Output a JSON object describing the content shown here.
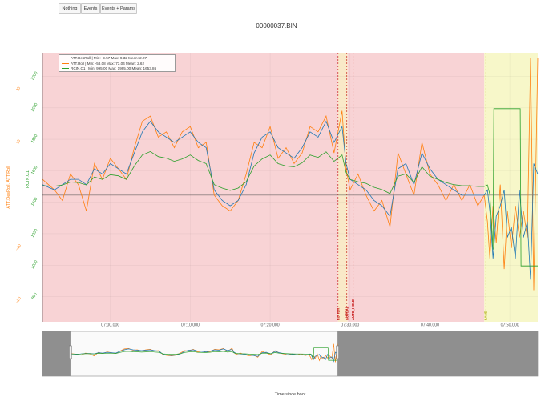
{
  "toolbar": {
    "buttons": [
      "Nothing",
      "Events",
      "Events + Params"
    ]
  },
  "colors": {
    "des_roll": "#1f77b4",
    "roll": "#ff7f0e",
    "rcin": "#2ca02c",
    "mode_red": "#f8d3d5",
    "mode_beige": "#f9e9c8",
    "mode_yellow": "#f7f7c9",
    "event_red": "#c00000",
    "event_yellow": "#a8a800"
  },
  "chart_data": {
    "type": "line",
    "title": "00000037.BIN",
    "xlabel": "Time since boot",
    "y_left_label": "ATT.DesRoll, ATT.Roll",
    "y_right_label": "RCIN.C1",
    "x_ticks": [
      "07:00.000",
      "07:10.000",
      "07:20.000",
      "07:30.000",
      "07:40.000",
      "07:50.000"
    ],
    "x_tick_seconds": [
      420,
      430,
      440,
      450,
      460,
      470
    ],
    "xlim_seconds": [
      411.5,
      473.5
    ],
    "yaxis_roll": {
      "range": [
        -24,
        27
      ],
      "ticks": [
        -20,
        -10,
        10,
        20
      ],
      "tick_labels": [
        "−20",
        "−10",
        "10",
        "20"
      ]
    },
    "yaxis_rcin": {
      "range": [
        640,
        2350
      ],
      "ticks": [
        800,
        1000,
        1200,
        1400,
        1600,
        1800,
        2000,
        2200
      ],
      "tick_labels": [
        "800",
        "1000",
        "1200",
        "1400",
        "1600",
        "1800",
        "2000",
        "2200"
      ]
    },
    "legend": [
      "ATT.DesRoll | Min: -9.57    Max: 9.32    Mean: 2.27",
      "ATT.Roll | Min: -58.08    Max: 73.04    Mean: 2.62",
      "RCIN.C1 | Min: 995.00    Max: 1995.00    Mean: 1653.86"
    ],
    "mode_bands": [
      {
        "from": 411.5,
        "to": 448.5,
        "color": "mode_red"
      },
      {
        "from": 448.5,
        "to": 449.7,
        "color": "mode_beige"
      },
      {
        "from": 449.7,
        "to": 466.8,
        "color": "mode_red"
      },
      {
        "from": 466.8,
        "to": 473.5,
        "color": "mode_yellow"
      }
    ],
    "events": [
      {
        "t": 448.5,
        "label": "LOITER",
        "color": "event_red"
      },
      {
        "t": 449.6,
        "label": "AUTOAL",
        "color": "event_red"
      },
      {
        "t": 450.4,
        "label": "AUTO_HOLD",
        "color": "event_red"
      },
      {
        "t": 467.0,
        "label": "LAND",
        "color": "event_yellow"
      }
    ],
    "series": [
      {
        "name": "ATT.DesRoll",
        "color": "des_roll",
        "x": [
          411.5,
          413,
          414,
          415,
          416,
          417,
          418,
          419,
          420,
          421,
          422,
          423,
          424,
          425,
          426,
          427,
          428,
          429,
          430,
          431,
          432,
          433,
          434,
          435,
          436,
          437,
          438,
          439,
          440,
          441,
          442,
          443,
          444,
          445,
          446,
          447,
          448,
          449,
          449.5,
          450,
          451,
          452,
          453,
          454,
          455,
          456,
          457,
          458,
          459,
          460,
          461,
          462,
          463,
          464,
          465,
          466,
          466.8,
          467.2,
          467.5,
          467.9,
          468.3,
          468.8,
          469.3,
          469.7,
          470.2,
          470.7,
          471.2,
          471.7,
          472.2,
          472.6,
          473,
          473.5
        ],
        "y": [
          2,
          1,
          2,
          3,
          3,
          2,
          5,
          4,
          6,
          5,
          4,
          8,
          12,
          14,
          12,
          11,
          10,
          11,
          12,
          10,
          9,
          1,
          -1,
          -2,
          -1,
          2,
          8,
          11,
          12,
          9,
          8,
          7,
          9,
          12,
          11,
          14,
          10,
          13,
          6,
          3,
          2,
          1,
          -1,
          -2,
          -4,
          5,
          6,
          2,
          8,
          5,
          3,
          2,
          1,
          0,
          0,
          0,
          0,
          1,
          -3,
          -12,
          -4,
          -2,
          1,
          -8,
          -6,
          -12,
          1,
          -8,
          -5,
          -16,
          6,
          4
        ]
      },
      {
        "name": "ATT.Roll",
        "color": "roll",
        "x": [
          411.5,
          413,
          414,
          415,
          416,
          417,
          418,
          419,
          420,
          421,
          422,
          423,
          424,
          425,
          426,
          427,
          428,
          429,
          430,
          431,
          432,
          433,
          434,
          435,
          436,
          437,
          438,
          439,
          440,
          441,
          442,
          443,
          444,
          445,
          446,
          447,
          448,
          449,
          449.5,
          450,
          451,
          452,
          453,
          454,
          455,
          456,
          457,
          458,
          459,
          460,
          461,
          462,
          463,
          464,
          465,
          466,
          466.8,
          467.2,
          467.5,
          467.9,
          468.3,
          468.8,
          469.3,
          469.7,
          470.2,
          470.7,
          471.2,
          471.7,
          472.2,
          472.6,
          473,
          473.5
        ],
        "y": [
          3,
          1,
          -1,
          4,
          2,
          -3,
          6,
          3,
          7,
          5,
          3,
          9,
          14,
          15,
          11,
          12,
          9,
          12,
          13,
          9,
          10,
          0,
          -2,
          -3,
          -1,
          4,
          10,
          9,
          13,
          7,
          9,
          6,
          8,
          13,
          12,
          15,
          8,
          16,
          5,
          1,
          4,
          0,
          -3,
          -1,
          -6,
          8,
          4,
          0,
          10,
          4,
          2,
          -1,
          2,
          -1,
          2,
          -2,
          0,
          -5,
          -12,
          -2,
          -9,
          2,
          -14,
          -3,
          -10,
          -2,
          -8,
          -3,
          -8,
          26,
          -18,
          26
        ]
      },
      {
        "name": "RCIN.C1",
        "color": "rcin",
        "x": [
          411.5,
          413,
          414,
          415,
          416,
          417,
          418,
          419,
          420,
          421,
          422,
          423,
          424,
          425,
          426,
          427,
          428,
          429,
          430,
          431,
          432,
          433,
          434,
          435,
          436,
          437,
          438,
          439,
          440,
          441,
          442,
          443,
          444,
          445,
          446,
          447,
          448,
          449,
          449.5,
          450,
          451,
          452,
          453,
          454,
          455,
          456,
          457,
          458,
          459,
          460,
          461,
          462,
          463,
          464,
          465,
          466,
          466.8,
          467.2,
          467.5,
          467.9,
          468,
          471.3,
          471.4,
          473.5
        ],
        "y": [
          1505,
          1502,
          1510,
          1528,
          1525,
          1510,
          1560,
          1545,
          1575,
          1568,
          1545,
          1630,
          1700,
          1722,
          1690,
          1680,
          1660,
          1675,
          1700,
          1665,
          1645,
          1512,
          1490,
          1475,
          1490,
          1530,
          1630,
          1675,
          1700,
          1645,
          1630,
          1625,
          1650,
          1700,
          1685,
          1720,
          1660,
          1700,
          1590,
          1545,
          1530,
          1520,
          1495,
          1480,
          1455,
          1565,
          1580,
          1525,
          1625,
          1565,
          1545,
          1525,
          1512,
          1505,
          1505,
          1500,
          1500,
          1510,
          1450,
          1100,
          1995,
          1995,
          995,
          995
        ]
      }
    ]
  }
}
